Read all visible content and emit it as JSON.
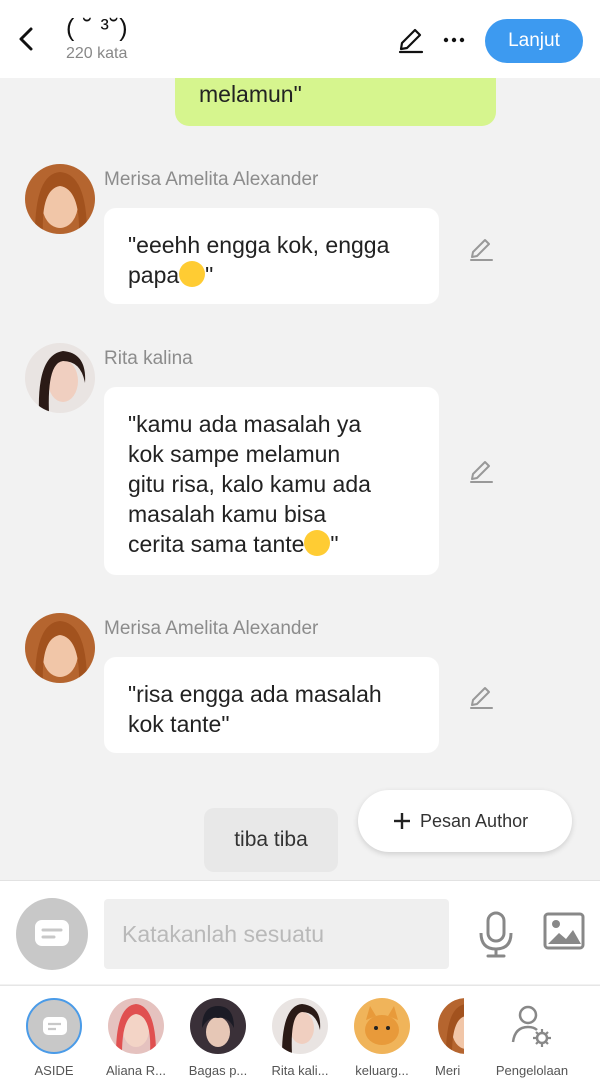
{
  "header": {
    "title": "( ˘ ³˘)",
    "subtitle": "220 kata",
    "next_label": "Lanjut"
  },
  "chat": {
    "self_message_tail": "melamun\"",
    "messages": [
      {
        "sender": "Merisa Amelita Alexander",
        "line1": "\"eeehh engga kok, engga",
        "line2": "papa",
        "line2_end": "\""
      },
      {
        "sender": "Rita kalina",
        "lines": [
          "\"kamu ada masalah ya",
          "kok sampe melamun",
          "gitu risa, kalo kamu ada",
          "masalah kamu bisa"
        ],
        "last": "cerita sama tante",
        "last_end": "\""
      },
      {
        "sender": "Merisa Amelita Alexander",
        "lines": [
          "\"risa engga ada masalah",
          "kok tante\""
        ]
      }
    ],
    "gray_bubble": "tiba tiba",
    "author_button": "Pesan Author"
  },
  "input": {
    "placeholder": "Katakanlah sesuatu"
  },
  "nav": {
    "items": [
      {
        "label": "ASIDE"
      },
      {
        "label": "Aliana R..."
      },
      {
        "label": "Bagas p..."
      },
      {
        "label": "Rita kali..."
      },
      {
        "label": "keluarg..."
      },
      {
        "label": "Meri"
      },
      {
        "label": "Pengelolaan"
      }
    ]
  },
  "colors": {
    "accent": "#3d9af0",
    "self_bubble": "#d6f58e"
  }
}
